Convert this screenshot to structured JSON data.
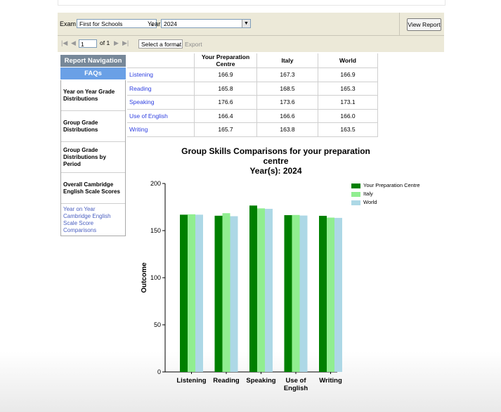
{
  "toolbar": {
    "exam_label": "Exam",
    "exam_value": "First for Schools",
    "year_label": "Year",
    "year_value": "2024",
    "view_report": "View Report",
    "page_value": "1",
    "page_of": "of 1",
    "format_select": "Select a format",
    "export": "Export"
  },
  "nav": {
    "header": "Report Navigation",
    "faqs": "FAQs",
    "items": [
      {
        "label": "Year on Year Grade Distributions"
      },
      {
        "label": "Group Grade Distributions"
      },
      {
        "label": "Group Grade Distributions by Period"
      },
      {
        "label": "Overall Cambridge English Scale Scores"
      },
      {
        "label": "Year on Year Cambridge English Scale Score Comparisons"
      }
    ]
  },
  "table": {
    "columns": [
      "Your Preparation Centre",
      "Italy",
      "World"
    ],
    "rows": [
      {
        "skill": "Listening",
        "values": [
          "166.9",
          "167.3",
          "166.9"
        ]
      },
      {
        "skill": "Reading",
        "values": [
          "165.8",
          "168.5",
          "165.3"
        ]
      },
      {
        "skill": "Speaking",
        "values": [
          "176.6",
          "173.6",
          "173.1"
        ]
      },
      {
        "skill": "Use of English",
        "values": [
          "166.4",
          "166.6",
          "166.0"
        ]
      },
      {
        "skill": "Writing",
        "values": [
          "165.7",
          "163.8",
          "163.5"
        ]
      }
    ]
  },
  "chart_data": {
    "type": "bar",
    "title": "Group Skills Comparisons for your preparation centre",
    "subtitle": "Year(s): 2024",
    "ylabel": "Outcome",
    "xlabel": "",
    "ylim": [
      0,
      200
    ],
    "yticks": [
      "0",
      "50",
      "100",
      "150",
      "200"
    ],
    "categories": [
      "Listening",
      "Reading",
      "Speaking",
      "Use of\nEnglish",
      "Writing"
    ],
    "series": [
      {
        "name": "Your Preparation Centre",
        "color": "#008000",
        "values": [
          166.9,
          165.8,
          176.6,
          166.4,
          165.7
        ]
      },
      {
        "name": "Italy",
        "color": "#90ee90",
        "values": [
          167.3,
          168.5,
          173.6,
          166.6,
          163.8
        ]
      },
      {
        "name": "World",
        "color": "#add8e6",
        "values": [
          166.9,
          165.3,
          173.1,
          166.0,
          163.5
        ]
      }
    ],
    "legend_position": "top-right",
    "grid": false
  }
}
